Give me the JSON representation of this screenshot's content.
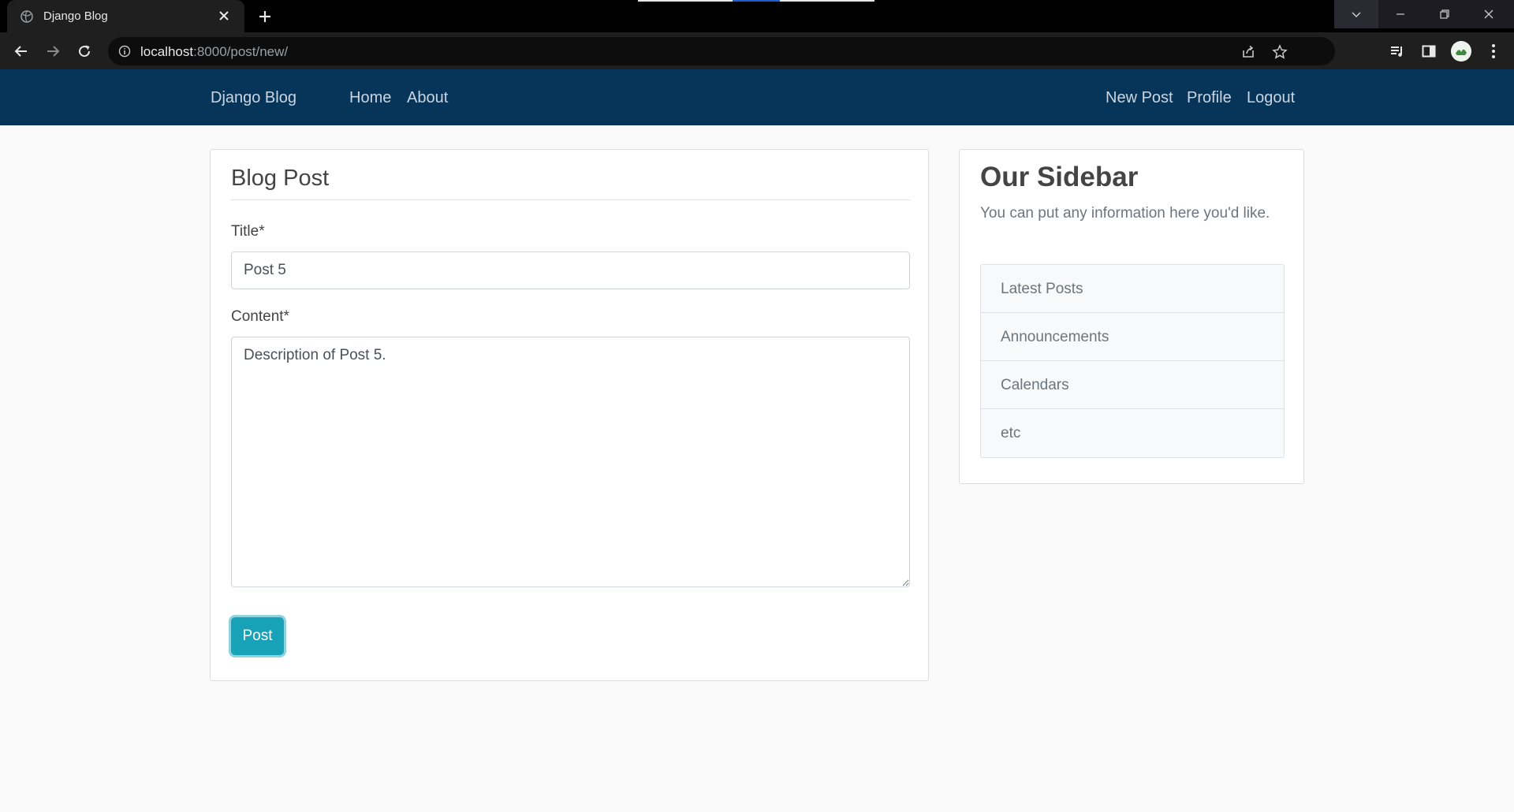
{
  "browser": {
    "tab_title": "Django Blog",
    "url_host": "localhost",
    "url_rest": ":8000/post/new/"
  },
  "navbar": {
    "brand": "Django Blog",
    "links_left": [
      "Home",
      "About"
    ],
    "links_right": [
      "New Post",
      "Profile",
      "Logout"
    ],
    "bg_color": "#063559"
  },
  "form": {
    "legend": "Blog Post",
    "title_label": "Title*",
    "title_value": "Post 5",
    "content_label": "Content*",
    "content_value": "Description of Post 5.",
    "submit_label": "Post",
    "submit_color": "#17a2b8"
  },
  "sidebar": {
    "title": "Our Sidebar",
    "text": "You can put any information here you'd like.",
    "items": [
      "Latest Posts",
      "Announcements",
      "Calendars",
      "etc"
    ]
  }
}
